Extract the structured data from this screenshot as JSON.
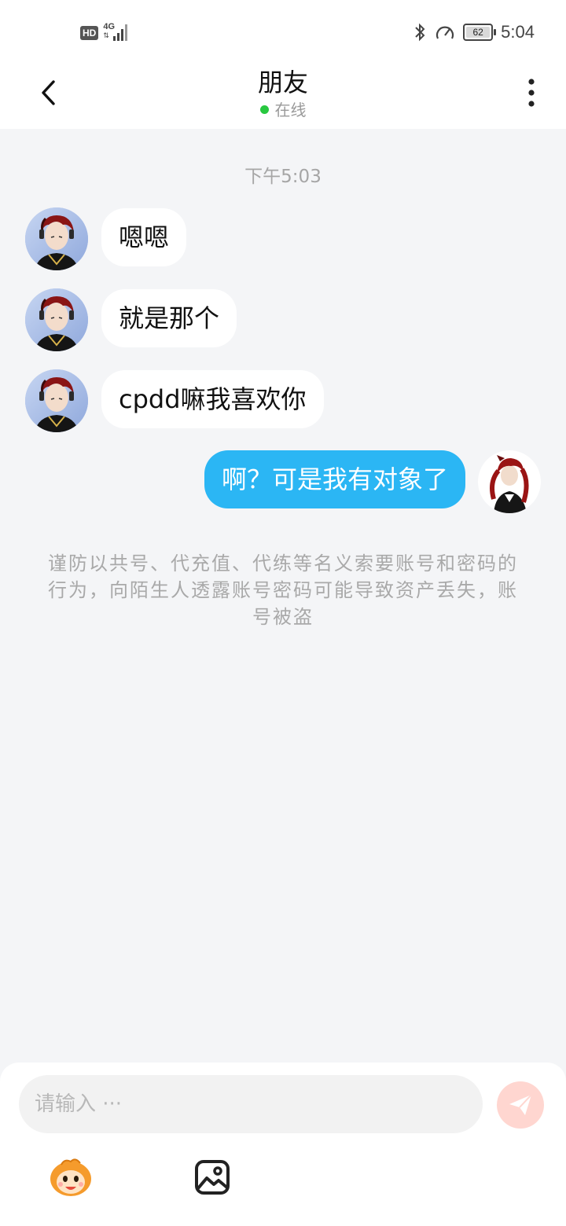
{
  "status_bar": {
    "hd": "HD",
    "network": "4G",
    "battery": "62",
    "time": "5:04"
  },
  "header": {
    "title": "朋友",
    "presence": "在线",
    "presence_color": "#28c840"
  },
  "chat": {
    "timestamp": "下午5:03",
    "messages": [
      {
        "from": "friend",
        "text": "嗯嗯"
      },
      {
        "from": "friend",
        "text": "就是那个"
      },
      {
        "from": "friend",
        "text": "cpdd嘛我喜欢你"
      },
      {
        "from": "me",
        "text": "啊？可是我有对象了"
      }
    ],
    "warning": "谨防以共号、代充值、代练等名义索要账号和密码的行为，向陌生人透露账号密码可能导致资产丢失，账号被盗"
  },
  "composer": {
    "placeholder": "请输入 ···",
    "icons": [
      "emoji-icon",
      "image-icon",
      "send-icon"
    ]
  },
  "colors": {
    "my_bubble": "#2bb6f4",
    "background": "#f4f5f7",
    "send_button": "#ffd6d0"
  }
}
